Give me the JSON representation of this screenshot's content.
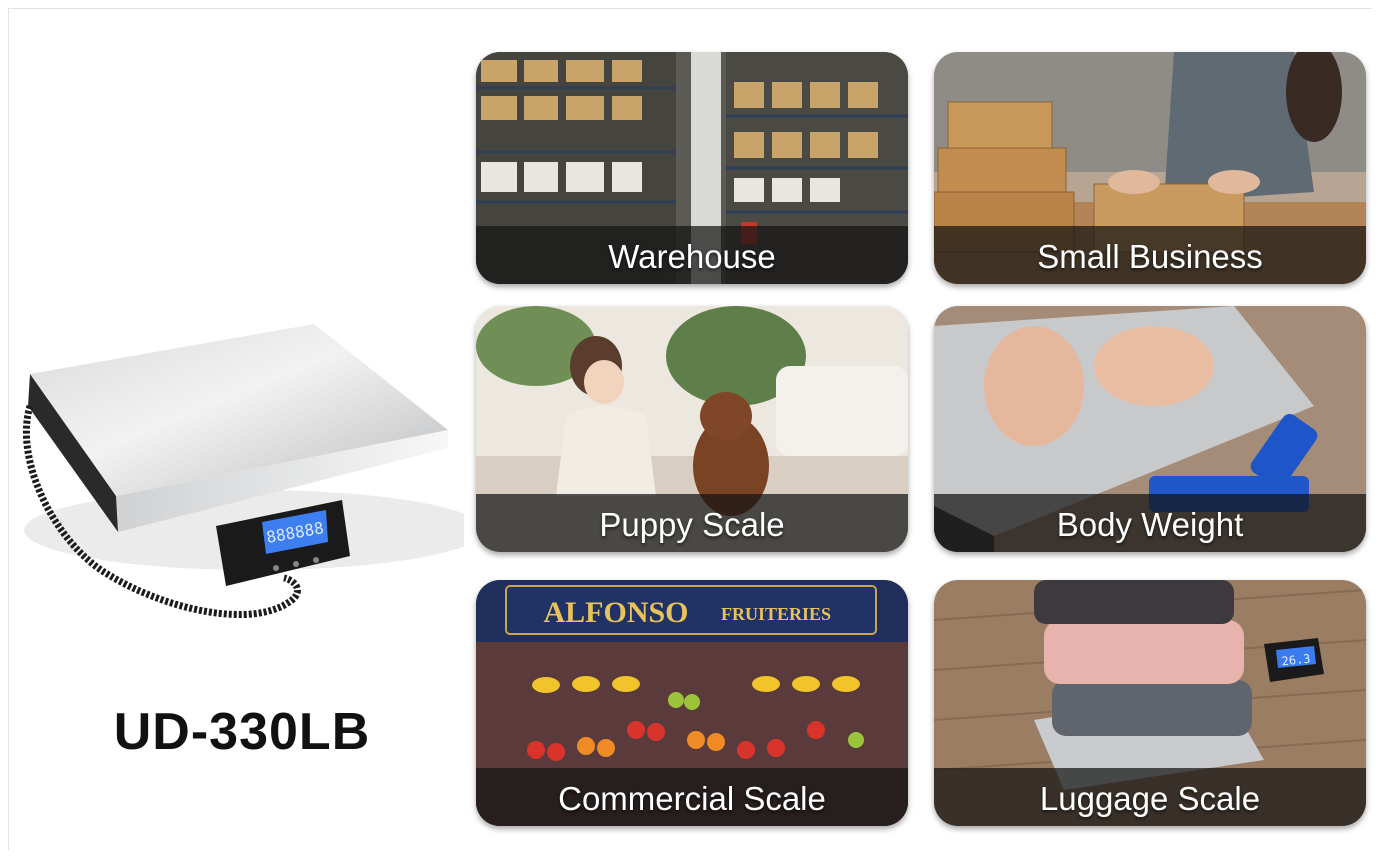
{
  "product": {
    "model": "UD-330LB",
    "display_reading": "888888"
  },
  "tiles": [
    {
      "label": "Warehouse"
    },
    {
      "label": "Small Business"
    },
    {
      "label": "Puppy Scale"
    },
    {
      "label": "Body Weight"
    },
    {
      "label": "Commercial Scale",
      "sign_name": "ALFONSO",
      "sign_sub": "FRUITERIES"
    },
    {
      "label": "Luggage Scale",
      "display_reading": "26.3"
    }
  ]
}
